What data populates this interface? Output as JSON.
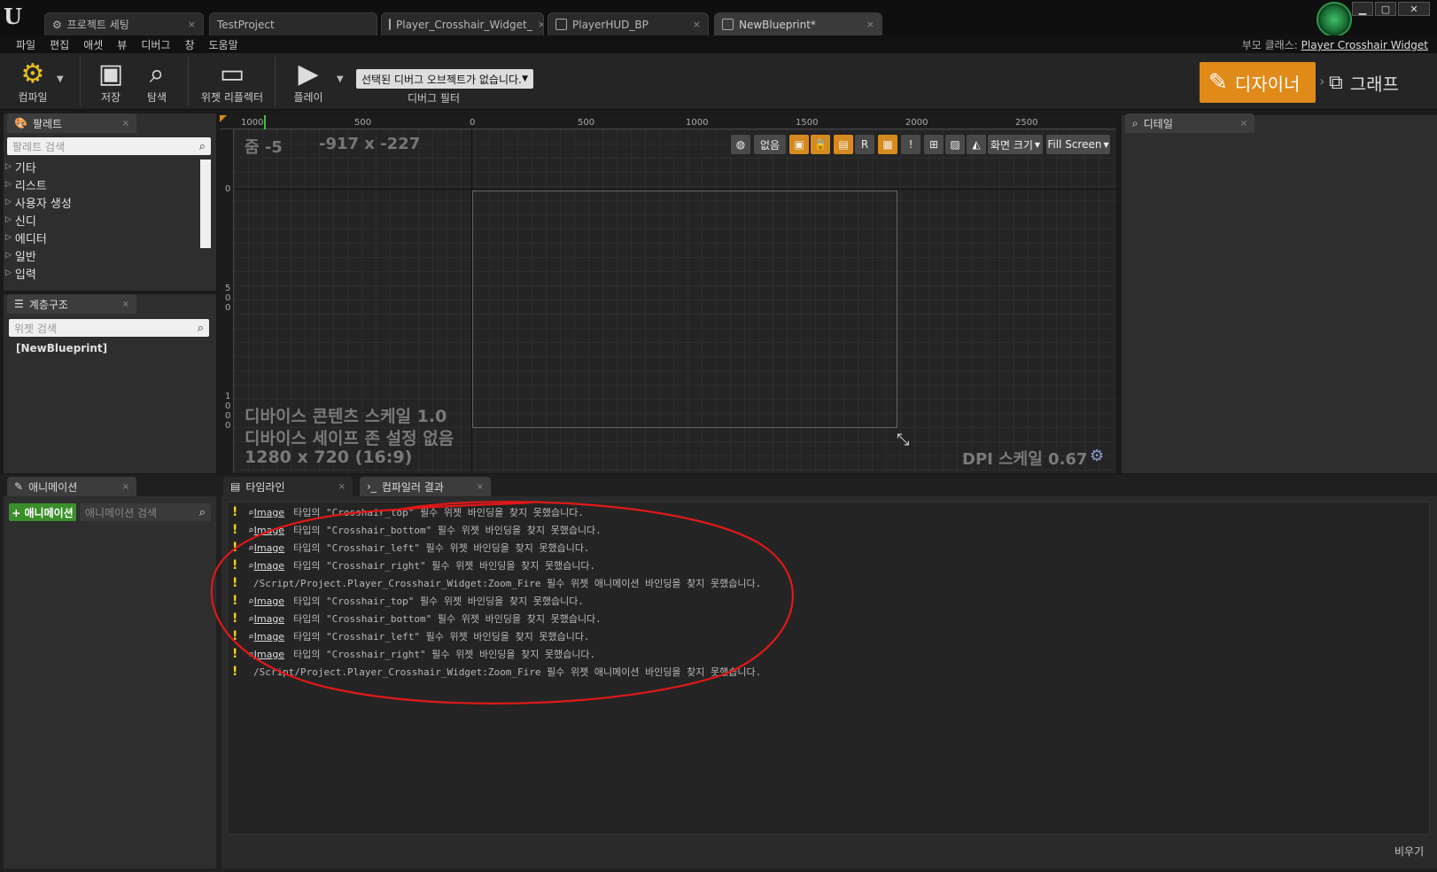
{
  "tabs": [
    {
      "label": "프로젝트 세팅",
      "closable": "×"
    },
    {
      "label": "TestProject",
      "closable": ""
    },
    {
      "label": "Player_Crosshair_Widget_",
      "closable": "×"
    },
    {
      "label": "PlayerHUD_BP",
      "closable": "×"
    },
    {
      "label": "NewBlueprint*",
      "closable": "×"
    }
  ],
  "menu": [
    "파일",
    "편집",
    "애셋",
    "뷰",
    "디버그",
    "창",
    "도움말"
  ],
  "parent_class": {
    "label": "부모 클래스:",
    "value": "Player Crosshair Widget"
  },
  "toolbar": {
    "compile": "컴파일",
    "save": "저장",
    "browse": "탐색",
    "widget_reflector": "위젯 리플렉터",
    "play": "플레이",
    "debug_select": "선택된 디버그 오브젝트가 없습니다.",
    "debug_filter": "디버그 필터",
    "designer": "디자이너",
    "graph": "그래프"
  },
  "palette": {
    "tab": "팔레트",
    "search_placeholder": "팔레트 검색",
    "items": [
      "기타",
      "리스트",
      "사용자 생성",
      "신디",
      "에디터",
      "일반",
      "입력"
    ]
  },
  "hierarchy": {
    "tab": "계층구조",
    "search_placeholder": "위젯 검색",
    "root": "[NewBlueprint]"
  },
  "viewport": {
    "zoom": "줌 -5",
    "coords": "-917 x -227",
    "ruler_top": [
      "1000",
      "500",
      "0",
      "500",
      "1000",
      "1500",
      "2000",
      "2500"
    ],
    "ruler_left": [
      "0",
      "5",
      "0",
      "0",
      "1",
      "0",
      "0",
      "0"
    ],
    "tool_none": "없음",
    "tool_r": "R",
    "tool_screen_size": "화면 크기",
    "tool_fill_screen": "Fill Screen",
    "content_scale": "디바이스 콘텐츠 스케일 1.0",
    "safe_zone": "디바이스 세이프 존 설정 없음",
    "resolution": "1280 x 720 (16:9)",
    "dpi_scale": "DPI 스케일 0.67"
  },
  "details": {
    "tab": "디테일"
  },
  "animation": {
    "tab": "애니메이션",
    "add_button": "+ 애니메이션",
    "search_placeholder": "애니메이션 검색"
  },
  "bottom_tabs": {
    "timeline": "타임라인",
    "compiler_results": "컴파일러 결과"
  },
  "log": [
    {
      "has_image": true,
      "link": "Image",
      "text": "타입의 \"Crosshair_top\" 필수 위젯 바인딩을 찾지 못했습니다."
    },
    {
      "has_image": true,
      "link": "Image",
      "text": "타입의 \"Crosshair_bottom\" 필수 위젯 바인딩을 찾지 못했습니다."
    },
    {
      "has_image": true,
      "link": "Image",
      "text": "타입의 \"Crosshair_left\" 필수 위젯 바인딩을 찾지 못했습니다."
    },
    {
      "has_image": true,
      "link": "Image",
      "text": "타입의 \"Crosshair_right\" 필수 위젯 바인딩을 찾지 못했습니다."
    },
    {
      "has_image": false,
      "link": "",
      "text": "/Script/Project.Player_Crosshair_Widget:Zoom_Fire  필수 위젯 애니메이션 바인딩을 찾지 못했습니다."
    },
    {
      "has_image": true,
      "link": "Image",
      "text": "타입의 \"Crosshair_top\" 필수 위젯 바인딩을 찾지 못했습니다."
    },
    {
      "has_image": true,
      "link": "Image",
      "text": "타입의 \"Crosshair_bottom\" 필수 위젯 바인딩을 찾지 못했습니다."
    },
    {
      "has_image": true,
      "link": "Image",
      "text": "타입의 \"Crosshair_left\" 필수 위젯 바인딩을 찾지 못했습니다."
    },
    {
      "has_image": true,
      "link": "Image",
      "text": "타입의 \"Crosshair_right\" 필수 위젯 바인딩을 찾지 못했습니다."
    },
    {
      "has_image": false,
      "link": "",
      "text": "/Script/Project.Player_Crosshair_Widget:Zoom_Fire  필수 위젯 애니메이션 바인딩을 찾지 못했습니다."
    }
  ],
  "clear_button": "비우기",
  "colors": {
    "accent_orange": "#e08a1a",
    "warning_yellow": "#f2d22a",
    "annotation_red": "#e01818"
  }
}
